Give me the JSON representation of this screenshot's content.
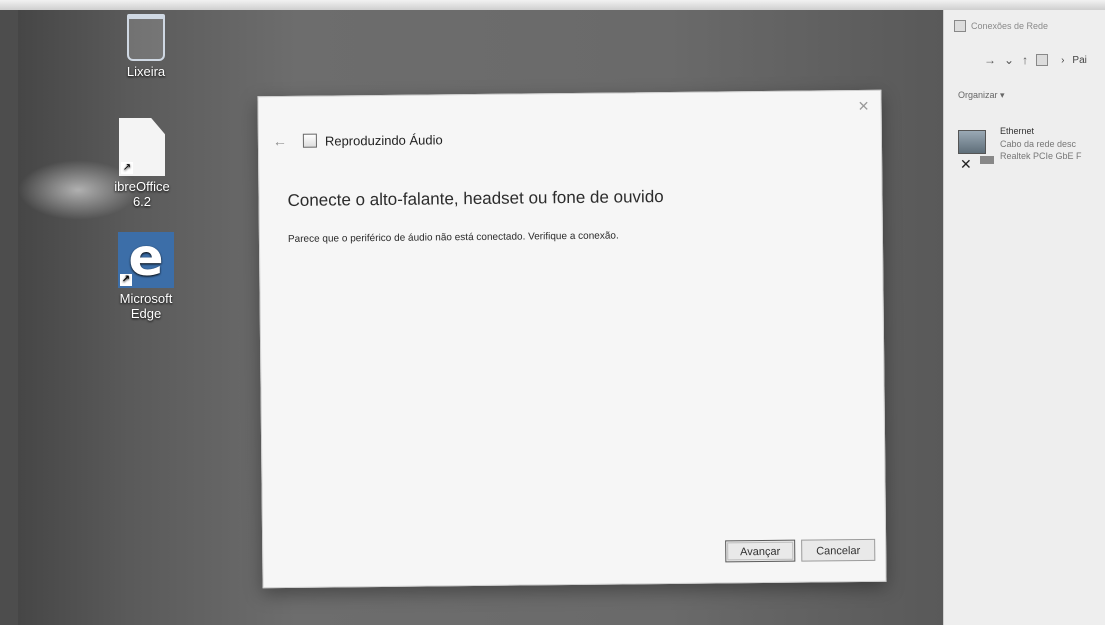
{
  "desktop": {
    "icons": [
      {
        "label": "Lixeira"
      },
      {
        "label": "ibreOffice 6.2"
      },
      {
        "label": "Microsoft Edge"
      }
    ]
  },
  "dialog": {
    "title": "Reproduzindo Áudio",
    "heading": "Conecte o alto-falante, headset ou fone de ouvido",
    "message": "Parece que o periférico de áudio não está conectado. Verifique a conexão.",
    "next_label": "Avançar",
    "cancel_label": "Cancelar"
  },
  "explorer": {
    "title": "Conexões de Rede",
    "breadcrumb": "Pai",
    "organize_label": "Organizar ▾",
    "item": {
      "name": "Ethernet",
      "status": "Cabo da rede desc",
      "adapter": "Realtek PCIe GbE F"
    }
  }
}
